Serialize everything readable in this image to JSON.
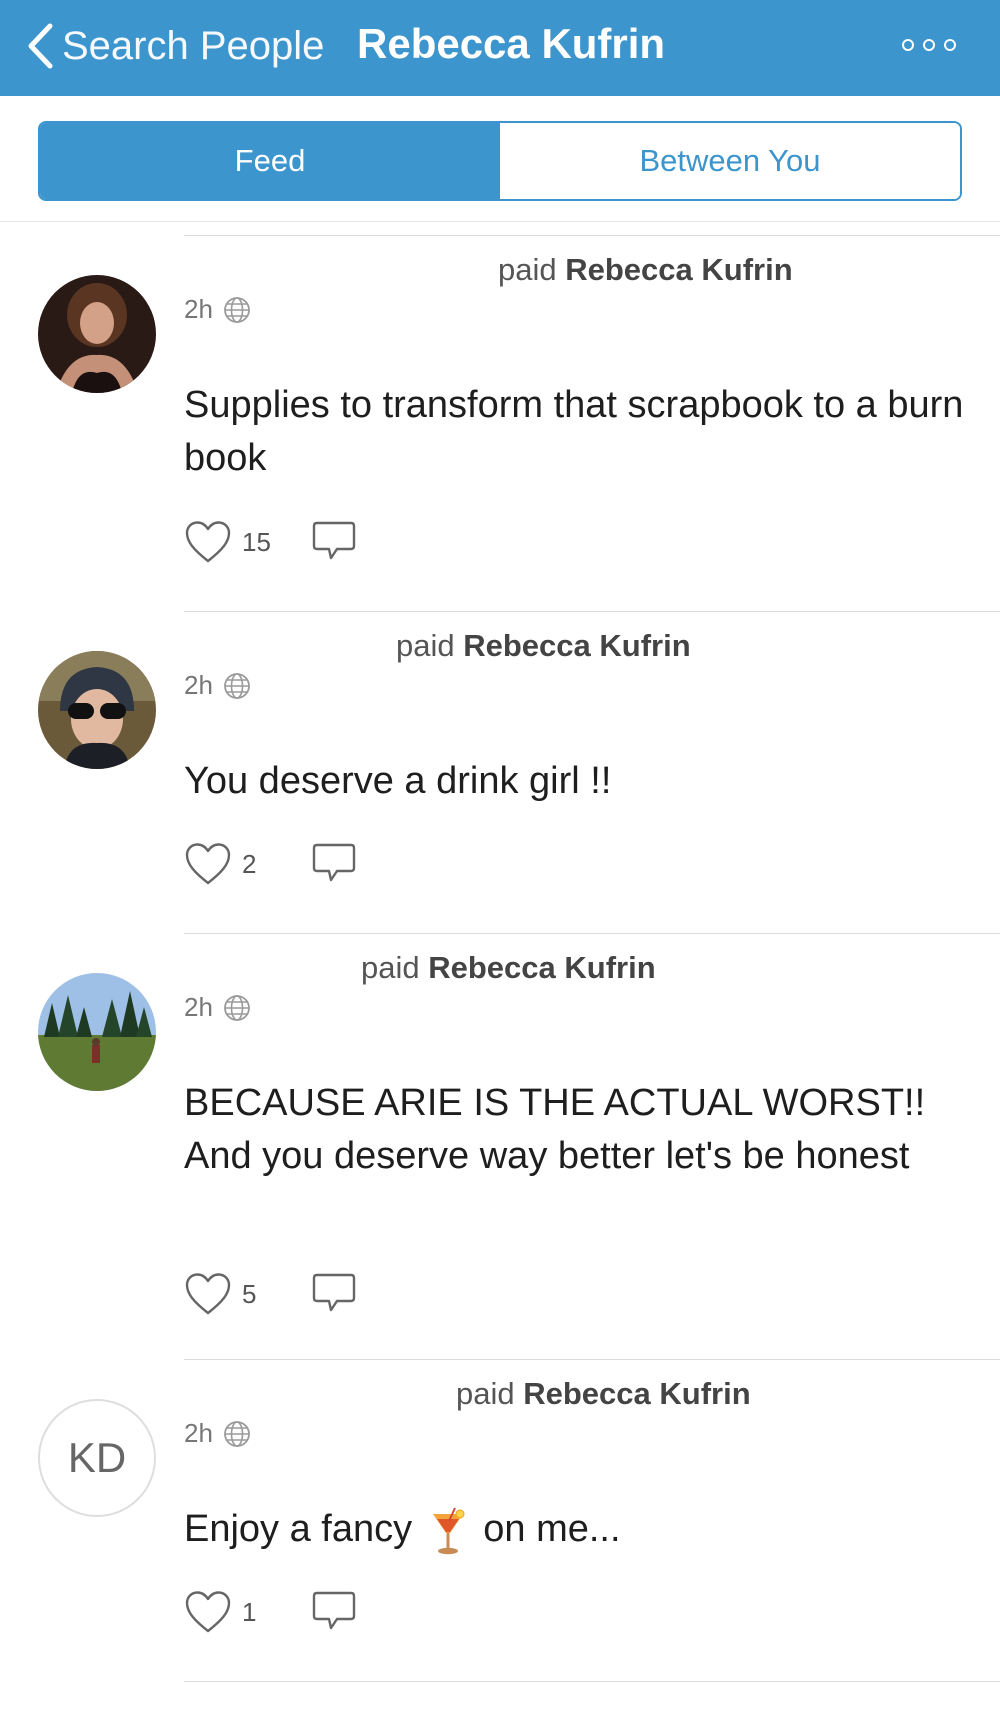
{
  "nav": {
    "back_label": "Search People",
    "title": "Rebecca Kufrin"
  },
  "tabs": [
    {
      "label": "Feed",
      "active": true
    },
    {
      "label": "Between You",
      "active": false
    }
  ],
  "posts": [
    {
      "action": "paid",
      "recipient": "Rebecca Kufrin",
      "time": "2h",
      "message": "Supplies to transform that scrapbook to a burn book",
      "likes": "15"
    },
    {
      "action": "paid",
      "recipient": "Rebecca Kufrin",
      "time": "2h",
      "message": "You deserve a drink girl !!",
      "likes": "2"
    },
    {
      "action": "paid",
      "recipient": "Rebecca Kufrin",
      "time": "2h",
      "message": "BECAUSE ARIE IS THE ACTUAL WORST!! And you deserve way better let's be honest",
      "likes": "5"
    },
    {
      "action": "paid",
      "recipient": "Rebecca Kufrin",
      "time": "2h",
      "avatar_initials": "KD",
      "message_before_emoji": "Enjoy a fancy",
      "emoji": "tropical-drink",
      "message_after_emoji": "on me...",
      "likes": "1"
    }
  ],
  "colors": {
    "brand_blue": "#3d95ce",
    "text_dark": "#1e1e1e",
    "text_muted": "#777777"
  }
}
